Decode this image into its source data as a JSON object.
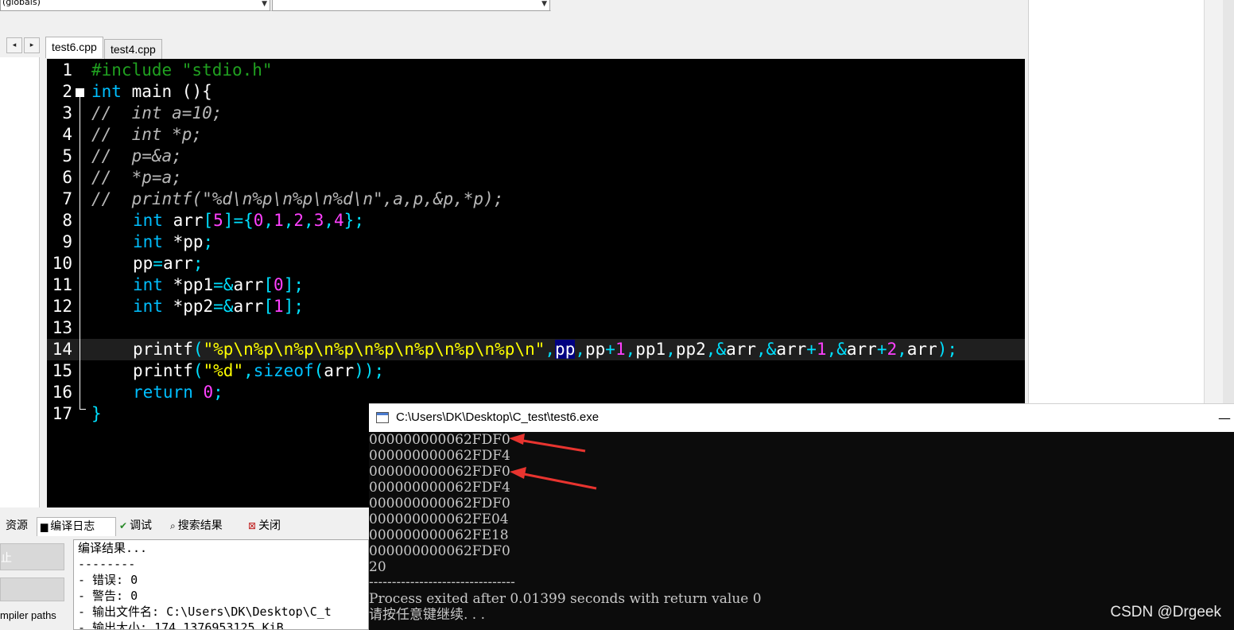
{
  "toolbar": {
    "scope_combo": "(globals)",
    "member_combo": ""
  },
  "editor_tabs": [
    {
      "label": "test6.cpp",
      "active": true
    },
    {
      "label": "test4.cpp",
      "active": false
    }
  ],
  "editor": {
    "line_numbers": [
      "1",
      "2",
      "3",
      "4",
      "5",
      "6",
      "7",
      "8",
      "9",
      "10",
      "11",
      "12",
      "13",
      "14",
      "15",
      "16",
      "17"
    ],
    "highlighted_line": 14,
    "colors": {
      "background": "#000000",
      "keyword": "#00bfff",
      "preprocessor": "#20a020",
      "comment": "#b8b8b8",
      "string": "#ffff00",
      "number": "#ff40ff",
      "symbol": "#00e0ff"
    },
    "code": {
      "l1_pp": "#include \"stdio.h\"",
      "l2_kw": "int",
      "l2_rest": " main (){",
      "l3": "//  int a=10;",
      "l4": "//  int *p;",
      "l5": "//  p=&a;",
      "l6": "//  *p=a;",
      "l7": "//  printf(\"%d\\n%p\\n%p\\n%d\\n\",a,p,&p,*p);",
      "l8_kw": "int",
      "l8_a": " arr",
      "l8_b": "[",
      "l8_c": "5",
      "l8_d": "]={",
      "l8_n0": "0",
      "l8_n1": "1",
      "l8_n2": "2",
      "l8_n3": "3",
      "l8_n4": "4",
      "l8_e": "};",
      "l9_kw": "int",
      "l9_a": " *pp",
      "l9_b": ";",
      "l10_a": "pp",
      "l10_b": "=",
      "l10_c": "arr",
      "l10_d": ";",
      "l11_kw": "int",
      "l11_a": " *pp1",
      "l11_b": "=&",
      "l11_c": "arr",
      "l11_d": "[",
      "l11_n": "0",
      "l11_e": "];",
      "l12_kw": "int",
      "l12_a": " *pp2",
      "l12_b": "=&",
      "l12_c": "arr",
      "l12_d": "[",
      "l12_n": "1",
      "l12_e": "];",
      "l14_fn": "printf",
      "l14_p": "(",
      "l14_str": "\"%p\\n%p\\n%p\\n%p\\n%p\\n%p\\n%p\\n%p\\n\"",
      "l14_c1": ",",
      "l14_sel": "pp",
      "l14_c2": ",",
      "l14_a": "pp",
      "l14_plus1": "+",
      "l14_n1": "1",
      "l14_c3": ",",
      "l14_b": "pp1",
      "l14_c4": ",",
      "l14_c": "pp2",
      "l14_c5": ",&",
      "l14_d": "arr",
      "l14_c6": ",&",
      "l14_e": "arr",
      "l14_plus2": "+",
      "l14_n2": "1",
      "l14_c7": ",&",
      "l14_f": "arr",
      "l14_plus3": "+",
      "l14_n3": "2",
      "l14_c8": ",",
      "l14_g": "arr",
      "l14_end": ");",
      "l15_fn": "printf",
      "l15_p": "(",
      "l15_str": "\"%d\"",
      "l15_c": ",",
      "l15_kw": "sizeof",
      "l15_p2": "(",
      "l15_a": "arr",
      "l15_end": "));",
      "l16_kw": "return",
      "l16_sp": " ",
      "l16_n": "0",
      "l16_e": ";",
      "l17": "}"
    }
  },
  "bottom_tabs": [
    {
      "icon": "resource-icon",
      "label": "资源"
    },
    {
      "icon": "chart-icon",
      "label": "编译日志"
    },
    {
      "icon": "check-icon",
      "label": "调试"
    },
    {
      "icon": "search-icon",
      "label": "搜索结果"
    },
    {
      "icon": "close-icon",
      "label": "关闭"
    }
  ],
  "left_button_partial": "止",
  "compiler_paths_label": "mpiler paths",
  "compile_log": [
    "编译结果...",
    "--------",
    "- 错误: 0",
    "- 警告: 0",
    "- 输出文件名: C:\\Users\\DK\\Desktop\\C_t",
    "- 输出大小: 174.1376953125 KiB"
  ],
  "console": {
    "title": "C:\\Users\\DK\\Desktop\\C_test\\test6.exe",
    "min_glyph": "—",
    "lines": [
      "000000000062FDF0",
      "000000000062FDF4",
      "000000000062FDF0",
      "000000000062FDF4",
      "000000000062FDF0",
      "000000000062FE04",
      "000000000062FE18",
      "000000000062FDF0",
      "20",
      "--------------------------------",
      "Process exited after 0.01399 seconds with return value 0",
      "请按任意键继续. . ."
    ]
  },
  "watermark": "CSDN @Drgeek",
  "annotation_color": "#e8342f"
}
